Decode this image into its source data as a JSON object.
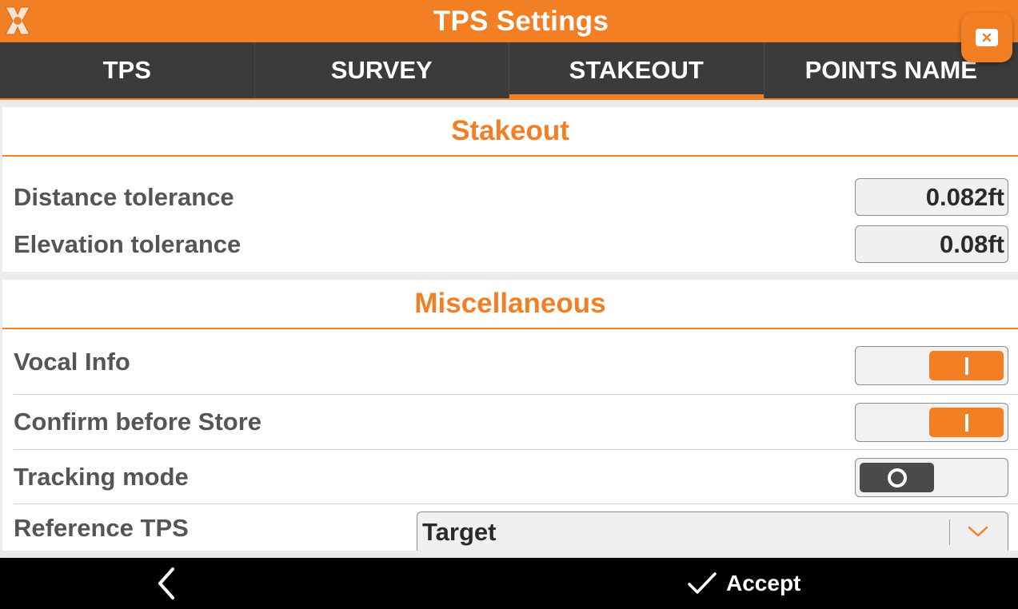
{
  "window": {
    "title": "TPS Settings"
  },
  "tabs": [
    {
      "label": "TPS",
      "active": false
    },
    {
      "label": "SURVEY",
      "active": false
    },
    {
      "label": "STAKEOUT",
      "active": true
    },
    {
      "label": "POINTS NAME",
      "active": false
    }
  ],
  "stakeout": {
    "heading": "Stakeout",
    "distance_tolerance": {
      "label": "Distance tolerance",
      "value": "0.082ft"
    },
    "elevation_tolerance": {
      "label": "Elevation tolerance",
      "value": "0.08ft"
    }
  },
  "misc": {
    "heading": "Miscellaneous",
    "vocal_info": {
      "label": "Vocal Info",
      "on": true
    },
    "confirm_before_store": {
      "label": "Confirm before Store",
      "on": true
    },
    "tracking_mode": {
      "label": "Tracking mode",
      "on": false
    },
    "reference_tps": {
      "label": "Reference TPS",
      "selected": "Target"
    }
  },
  "footer": {
    "accept_label": "Accept"
  },
  "icons": {
    "logo": "app-logo-icon",
    "close": "close-icon",
    "back": "chevron-left-icon",
    "accept": "checkmark-icon",
    "dropdown": "chevron-down-icon"
  },
  "colors": {
    "accent": "#f37f25",
    "tabbar": "#3b3b3b",
    "toggle_off_knob": "#4a4a4a",
    "bottombar": "#000000"
  }
}
